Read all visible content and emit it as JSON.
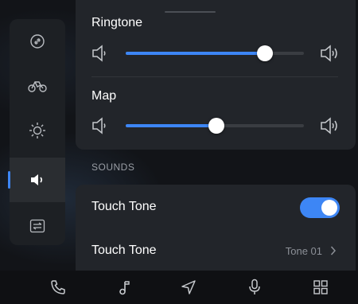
{
  "sections": {
    "ringtone": {
      "label": "Ringtone",
      "level": 0.78
    },
    "map": {
      "label": "Map",
      "level": 0.51
    }
  },
  "sounds_header": "SOUNDS",
  "rows": {
    "touch_tone_toggle": {
      "label": "Touch Tone",
      "enabled": true
    },
    "touch_tone_select": {
      "label": "Touch Tone",
      "value": "Tone 01"
    }
  },
  "sidebar": {
    "items": [
      {
        "icon": "link-icon"
      },
      {
        "icon": "vehicle-icon"
      },
      {
        "icon": "brightness-icon"
      },
      {
        "icon": "volume-icon",
        "active": true
      },
      {
        "icon": "transfer-icon"
      }
    ]
  },
  "nav": {
    "items": [
      {
        "icon": "phone-icon"
      },
      {
        "icon": "music-icon"
      },
      {
        "icon": "navigation-icon"
      },
      {
        "icon": "microphone-icon"
      },
      {
        "icon": "apps-grid-icon"
      }
    ]
  },
  "colors": {
    "accent": "#3d86f5",
    "card": "#22252a",
    "background": "#121418"
  }
}
